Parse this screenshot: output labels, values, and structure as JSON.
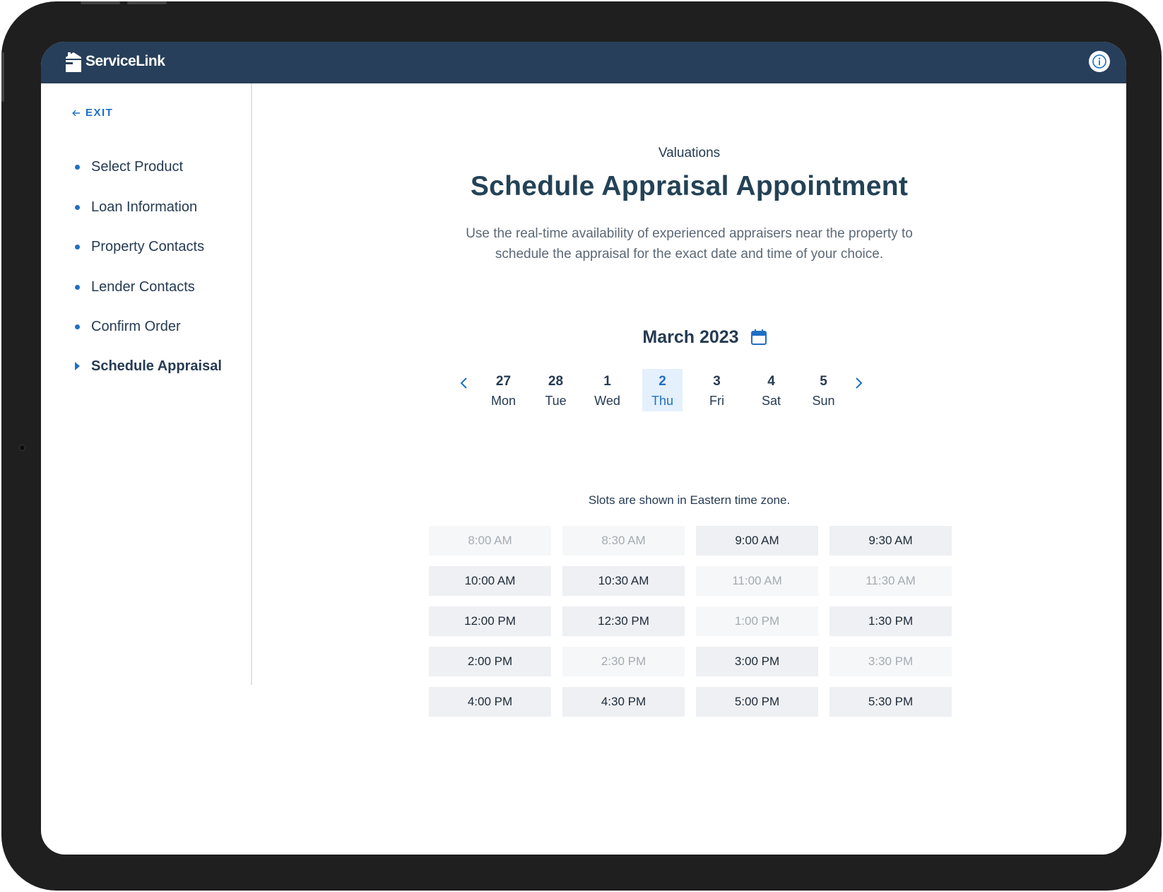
{
  "app": {
    "brand": "ServiceLink"
  },
  "colors": {
    "header": "#273f5a",
    "accent": "#1f6fc4",
    "text": "#263b52",
    "selected_day_bg": "#e4f0fc"
  },
  "sidebar": {
    "exit_label": "EXIT",
    "items": [
      {
        "label": "Select Product",
        "state": "done"
      },
      {
        "label": "Loan Information",
        "state": "done"
      },
      {
        "label": "Property Contacts",
        "state": "done"
      },
      {
        "label": "Lender Contacts",
        "state": "done"
      },
      {
        "label": "Confirm Order",
        "state": "done"
      },
      {
        "label": "Schedule Appraisal",
        "state": "active"
      }
    ]
  },
  "main": {
    "eyebrow": "Valuations",
    "title": "Schedule Appraisal Appointment",
    "description_line1": "Use the real-time availability of experienced appraisers near the property to",
    "description_line2": "schedule the appraisal for the exact date and time of your choice.",
    "calendar": {
      "month_label": "March 2023",
      "days": [
        {
          "num": "27",
          "weekday": "Mon",
          "selected": false
        },
        {
          "num": "28",
          "weekday": "Tue",
          "selected": false
        },
        {
          "num": "1",
          "weekday": "Wed",
          "selected": false
        },
        {
          "num": "2",
          "weekday": "Thu",
          "selected": true
        },
        {
          "num": "3",
          "weekday": "Fri",
          "selected": false
        },
        {
          "num": "4",
          "weekday": "Sat",
          "selected": false
        },
        {
          "num": "5",
          "weekday": "Sun",
          "selected": false
        }
      ]
    },
    "timezone_note": "Slots are shown in Eastern time zone.",
    "slots": [
      {
        "time": "8:00 AM",
        "available": false
      },
      {
        "time": "8:30 AM",
        "available": false
      },
      {
        "time": "9:00 AM",
        "available": true
      },
      {
        "time": "9:30 AM",
        "available": true
      },
      {
        "time": "10:00 AM",
        "available": true
      },
      {
        "time": "10:30 AM",
        "available": true
      },
      {
        "time": "11:00 AM",
        "available": false
      },
      {
        "time": "11:30 AM",
        "available": false
      },
      {
        "time": "12:00 PM",
        "available": true
      },
      {
        "time": "12:30 PM",
        "available": true
      },
      {
        "time": "1:00 PM",
        "available": false
      },
      {
        "time": "1:30 PM",
        "available": true
      },
      {
        "time": "2:00 PM",
        "available": true
      },
      {
        "time": "2:30 PM",
        "available": false
      },
      {
        "time": "3:00 PM",
        "available": true
      },
      {
        "time": "3:30 PM",
        "available": false
      },
      {
        "time": "4:00 PM",
        "available": true
      },
      {
        "time": "4:30 PM",
        "available": true
      },
      {
        "time": "5:00 PM",
        "available": true
      },
      {
        "time": "5:30 PM",
        "available": true
      }
    ]
  },
  "icons": {
    "logo": "house-logo-icon",
    "info": "info-icon",
    "exit": "arrow-left-icon",
    "calendar": "calendar-icon",
    "prev": "chevron-left-icon",
    "next": "chevron-right-icon"
  }
}
